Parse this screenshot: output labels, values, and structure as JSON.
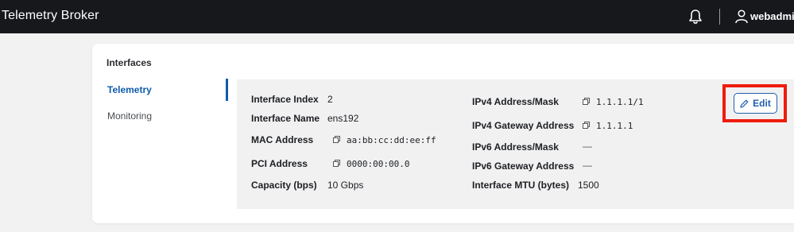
{
  "header": {
    "app_title": "Telemetry Broker",
    "user_name": "webadmin"
  },
  "card": {
    "title": "Interfaces"
  },
  "sidebar": {
    "items": [
      {
        "label": "Telemetry",
        "active": true
      },
      {
        "label": "Monitoring",
        "active": false
      }
    ]
  },
  "details_left": {
    "interface_index": {
      "label": "Interface Index",
      "value": "2"
    },
    "interface_name": {
      "label": "Interface Name",
      "value": "ens192"
    },
    "mac_address": {
      "label": "MAC Address",
      "value": "aa:bb:cc:dd:ee:ff"
    },
    "pci_address": {
      "label": "PCI Address",
      "value": "0000:00:00.0"
    },
    "capacity": {
      "label": "Capacity (bps)",
      "value": "10 Gbps"
    }
  },
  "details_right": {
    "ipv4_address": {
      "label": "IPv4 Address/Mask",
      "value": "1.1.1.1/1"
    },
    "ipv4_gateway": {
      "label": "IPv4 Gateway Address",
      "value": "1.1.1.1"
    },
    "ipv6_address": {
      "label": "IPv6 Address/Mask",
      "value": "—"
    },
    "ipv6_gateway": {
      "label": "IPv6 Gateway Address",
      "value": "—"
    },
    "mtu": {
      "label": "Interface MTU (bytes)",
      "value": "1500"
    }
  },
  "actions": {
    "edit_label": "Edit"
  },
  "colors": {
    "topbar": "#16181c",
    "accent": "#0d5cab",
    "highlight": "#ee1c0c"
  }
}
